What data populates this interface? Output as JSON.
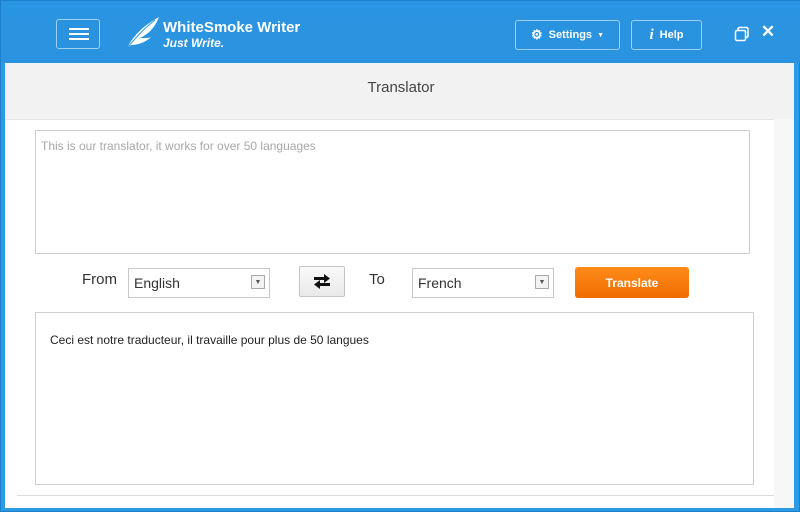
{
  "app": {
    "title": "WhiteSmoke Writer",
    "tagline": "Just Write."
  },
  "toolbar": {
    "settings_label": "Settings",
    "help_label": "Help"
  },
  "page": {
    "title": "Translator"
  },
  "translator": {
    "source_placeholder": "This is our translator, it works for over 50 languages",
    "source_value": "",
    "from_label": "From",
    "from_value": "English",
    "to_label": "To",
    "to_value": "French",
    "translate_label": "Translate",
    "output_text": "Ceci est notre traducteur, il travaille pour plus de 50 langues"
  },
  "icons": {
    "menu": "hamburger-icon",
    "logo": "quill-feather-icon",
    "settings": "gear-icon",
    "help": "info-icon",
    "restore": "restore-window-icon",
    "close": "close-icon",
    "swap": "swap-arrows-icon",
    "dropdown": "chevron-down-icon"
  },
  "colors": {
    "titlebar": "#2a93e0",
    "accent_button": "#f57a0a",
    "content_bg": "#ffffff"
  }
}
